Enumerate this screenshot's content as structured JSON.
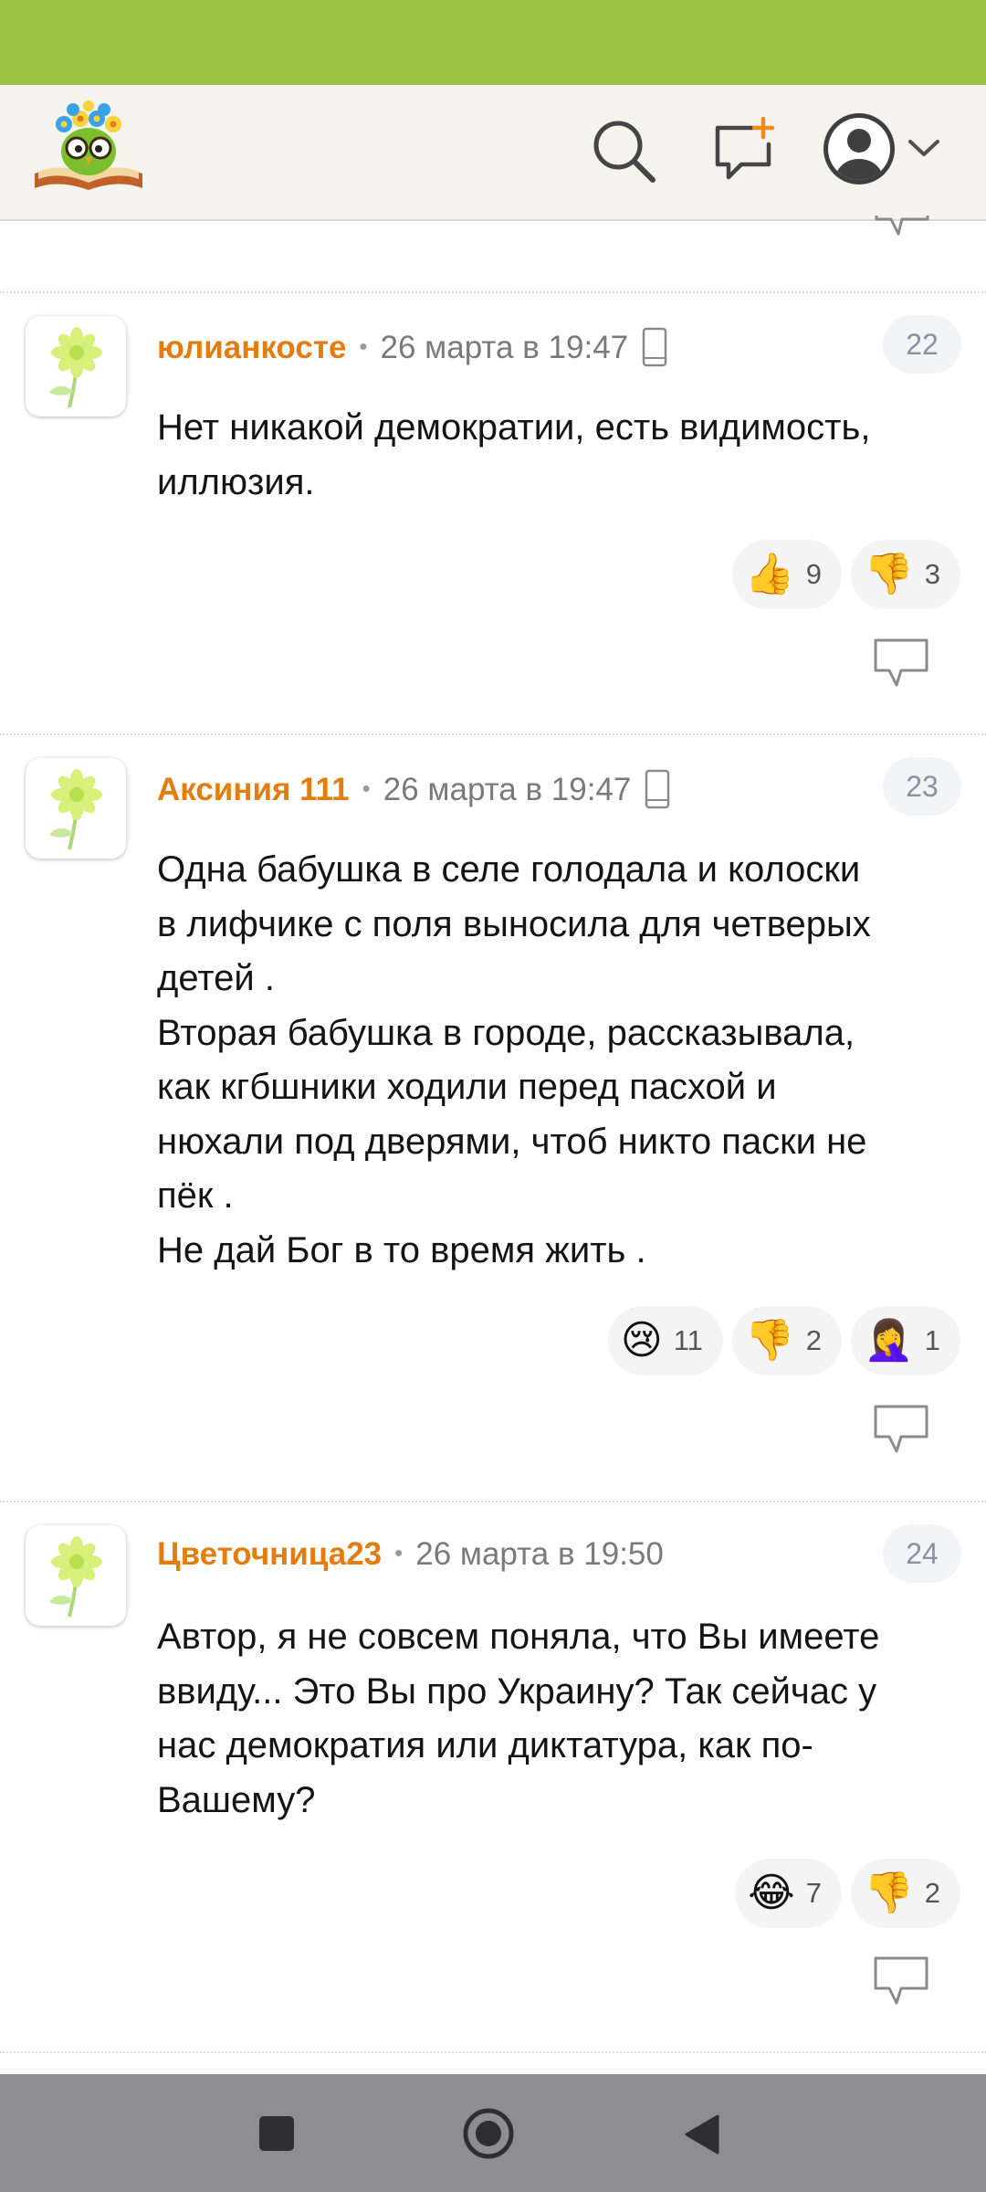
{
  "colors": {
    "status_bar": "#9dc242",
    "header_bg": "#f4f3ee",
    "author": "#e37d10",
    "nav_bar": "#8e8e92"
  },
  "header": {
    "logo": "owl-with-flowers-logo",
    "icons": [
      "search-icon",
      "create-post-icon",
      "user-avatar-icon",
      "chevron-down-icon"
    ]
  },
  "comments": [
    {
      "author": "юлианкосте",
      "date": "26 марта в 19:47",
      "device_icon": "mobile-phone-icon",
      "number": "22",
      "lines": [
        "Нет никакой демократии, есть видимость,",
        "иллюзия."
      ],
      "reactions": [
        {
          "emoji": "👍",
          "icon": "thumbs-up-icon",
          "count": "9"
        },
        {
          "emoji": "👎",
          "icon": "thumbs-down-icon",
          "count": "3"
        }
      ]
    },
    {
      "author": "Аксиния 111",
      "date": "26 марта в 19:47",
      "device_icon": "mobile-phone-icon",
      "number": "23",
      "lines": [
        "Одна бабушка в селе голодала и колоски",
        "в лифчике с поля выносила для четверых",
        "детей .",
        "Вторая бабушка в городе, рассказывала,",
        "как кгбшники ходили перед пасхой и",
        "нюхали под дверями, чтоб никто паски не",
        "пёк .",
        "Не дай Бог в то время жить ."
      ],
      "reactions": [
        {
          "emoji": "😢",
          "icon": "crying-face-icon",
          "count": "11"
        },
        {
          "emoji": "👎",
          "icon": "thumbs-down-icon",
          "count": "2"
        },
        {
          "emoji": "🤦‍♀️",
          "icon": "facepalm-icon",
          "count": "1"
        }
      ]
    },
    {
      "author": "Цветочница23",
      "date": "26 марта в 19:50",
      "number": "24",
      "lines": [
        "Автор, я не совсем поняла, что Вы имеете",
        "ввиду... Это Вы про Украину? Так сейчас у",
        "нас демократия или диктатура, как по-",
        "Вашему?"
      ],
      "reactions": [
        {
          "emoji": "😂",
          "icon": "tears-of-joy-icon",
          "count": "7"
        },
        {
          "emoji": "👎",
          "icon": "thumbs-down-icon",
          "count": "2"
        }
      ]
    }
  ],
  "navbar": {
    "icons": [
      "recents-square-icon",
      "home-circle-icon",
      "back-triangle-icon"
    ]
  }
}
